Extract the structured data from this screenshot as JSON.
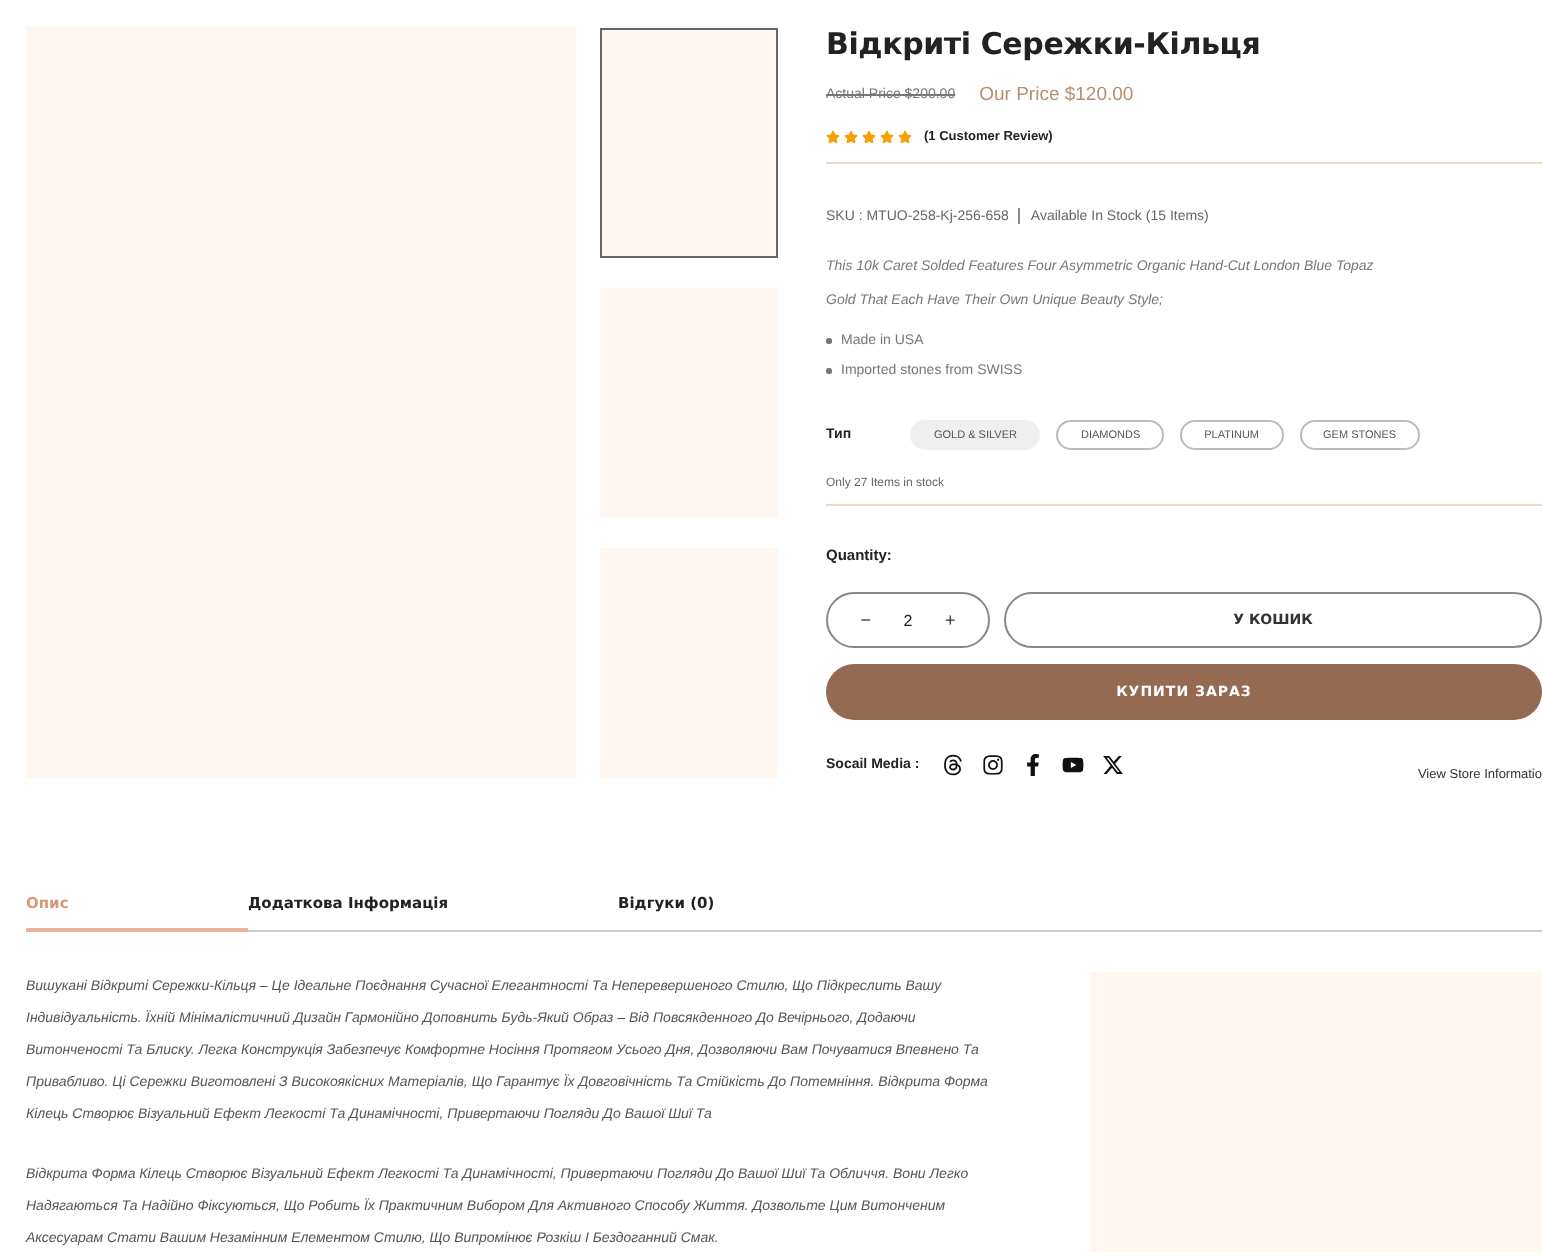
{
  "gallery": {
    "thumbnails": [
      {
        "selected": true
      },
      {
        "selected": false
      },
      {
        "selected": false
      }
    ]
  },
  "product": {
    "title": "Відкриті Сережки-Кільця",
    "old_price": "Actual Price $200.00",
    "price": "Our Price $120.00",
    "stars": 5,
    "reviews": "(1 Customer Review)",
    "sku": "SKU : MTUO-258-Kj-256-658",
    "stock": "Available In Stock (15 Items)",
    "description": "This 10k Caret Solded Features Four Asymmetric Organic Hand-Cut London Blue Topaz Gold That Each Have Their Own Unique Beauty Style;",
    "features": [
      "Made in USA",
      "Imported stones from SWISS"
    ],
    "type_label": "Тип",
    "options": [
      {
        "label": "GOLD & SILVER",
        "selected": true
      },
      {
        "label": "DIAMONDS",
        "selected": false
      },
      {
        "label": "PLATINUM",
        "selected": false
      },
      {
        "label": "GEM STONES",
        "selected": false
      }
    ],
    "stock_note": "Only 27 Items in stock",
    "quantity_label": "Quantity:",
    "quantity": {
      "minus": "−",
      "value": "2",
      "plus": "+"
    },
    "cart_button": "У КОШИК",
    "buy_button": "КУПИТИ ЗАРАЗ",
    "social_label": "Socail Media :",
    "store_link": "View Store Informatio"
  },
  "tabs": [
    {
      "label": "Опис",
      "selected": true
    },
    {
      "label": "Додаткова Інформація",
      "selected": false
    },
    {
      "label": "Відгуки (0)",
      "selected": false
    }
  ],
  "paragraphs": [
    "Вишукані Відкриті Сережки-Кільця – Це Ідеальне Поєднання Сучасної Елегантності Та Неперевершеного Стилю, Що Підкреслить Вашу Індивідуальність. Їхній Мінімалістичний Дизайн Гармонійно Доповнить Будь-Який Образ – Від Повсякденного До Вечірнього, Додаючи Витонченості Та Блиску. Легка Конструкція Забезпечує Комфортне Носіння Протягом Усього Дня, Дозволяючи Вам Почуватися Впевнено Та Привабливо. Ці Сережки Виготовлені З Високоякісних Матеріалів, Що Гарантує Їх Довговічність Та Стійкість До Потемніння. Відкрита Форма Кілець Створює Візуальний Ефект Легкості Та Динамічності, Привертаючи Погляди До Вашої Шиї Та",
    "Відкрита Форма Кілець Створює Візуальний Ефект Легкості Та Динамічності, Привертаючи Погляди До Вашої Шиї Та Обличчя. Вони Легко Надягаються Та Надійно Фіксуються, Що Робить Їх Практичним Вибором Для Активного Способу Життя. Дозвольте Цим Витонченим Аксесуарам Стати Вашим Незамінним Елементом Стилю, Що Випромінює Розкіш І Бездоганний Смак."
  ]
}
